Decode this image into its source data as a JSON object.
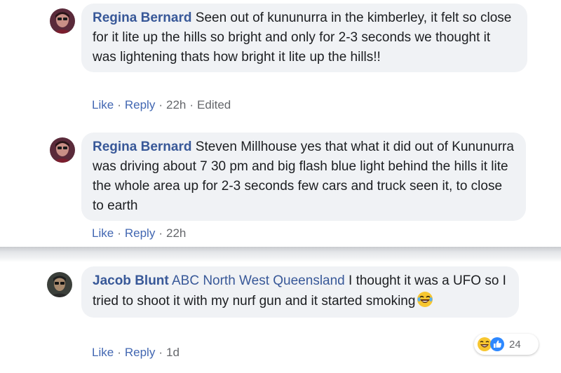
{
  "comments": [
    {
      "author": "Regina Bernard",
      "text": "Seen out of kununurra in the kimberley, it felt so close for it lite up the hills so bright and only for 2-3 seconds we thought it was lightening thats how bright it lite up the hills!!",
      "actions": {
        "like": "Like",
        "reply": "Reply",
        "time": "22h",
        "edited": "Edited"
      }
    },
    {
      "author": "Regina Bernard",
      "text": "Steven Millhouse yes that what it did out of Kununurra was driving about 7 30 pm and big flash blue light behind the hills it lite the whole area up for 2-3 seconds few cars and truck seen it, to close to earth",
      "actions": {
        "like": "Like",
        "reply": "Reply",
        "time": "22h"
      }
    },
    {
      "author": "Jacob Blunt",
      "mention": "ABC North West Queensland",
      "text": "I thought it was a UFO so I tried to shoot it with my nurf gun and it started smoking",
      "actions": {
        "like": "Like",
        "reply": "Reply",
        "time": "1d"
      },
      "reactions": {
        "count": "24",
        "icons": [
          "laughing-face-icon",
          "like-thumb-icon"
        ]
      }
    }
  ],
  "separator": "·",
  "colors": {
    "author": "#385898",
    "link": "#4267b2",
    "meta": "#65676b",
    "bubble": "#f0f2f5"
  }
}
